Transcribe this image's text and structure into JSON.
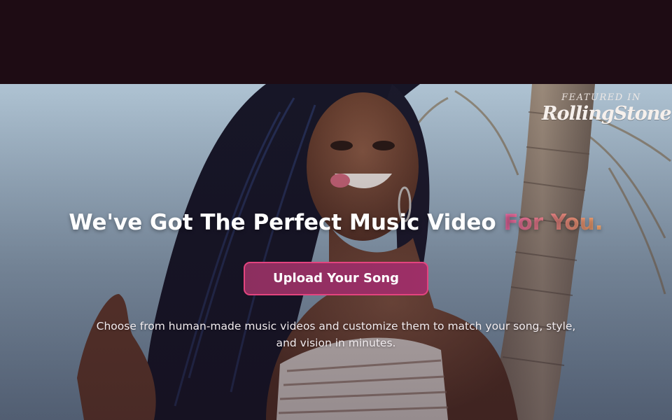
{
  "hero": {
    "featured_label": "FEATURED IN",
    "featured_logo_text": "RollingStone",
    "headline_main": "We've Got The Perfect Music Video ",
    "headline_accent": "For You.",
    "cta_label": "Upload Your Song",
    "subtext": "Choose from human-made music videos and customize them to match your song, style, and vision in minutes."
  },
  "colors": {
    "topbar_bg": "#1e0c14",
    "cta_bg": "#9a2f66",
    "cta_border": "#e3447f",
    "accent_start": "#f06aa7",
    "accent_end": "#f5a86a"
  }
}
